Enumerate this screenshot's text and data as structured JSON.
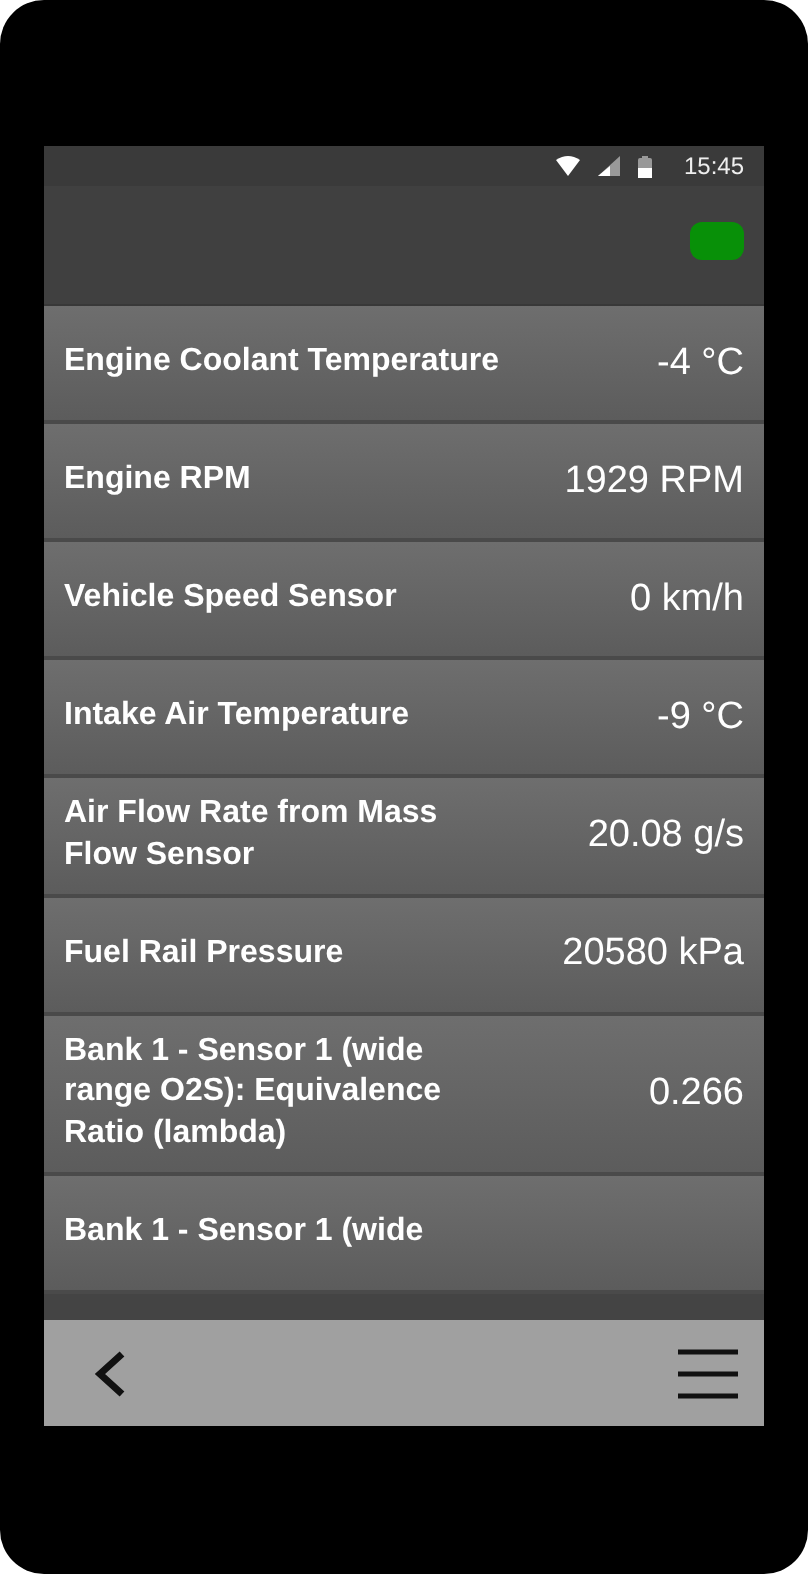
{
  "status_bar": {
    "time": "15:45"
  },
  "app_bar": {
    "connected": true
  },
  "readings": [
    {
      "name": "Engine Coolant Temperature",
      "value": "-4 °C"
    },
    {
      "name": "Engine RPM",
      "value": "1929 RPM"
    },
    {
      "name": "Vehicle Speed Sensor",
      "value": "0 km/h"
    },
    {
      "name": "Intake Air Temperature",
      "value": "-9 °C"
    },
    {
      "name": "Air Flow Rate from Mass Flow Sensor",
      "value": "20.08 g/s"
    },
    {
      "name": "Fuel Rail Pressure",
      "value": "20580 kPa"
    },
    {
      "name": "Bank 1 - Sensor 1 (wide range O2S): Equivalence Ratio (lambda)",
      "value": "0.266"
    },
    {
      "name": "Bank 1 - Sensor 1 (wide"
    }
  ]
}
